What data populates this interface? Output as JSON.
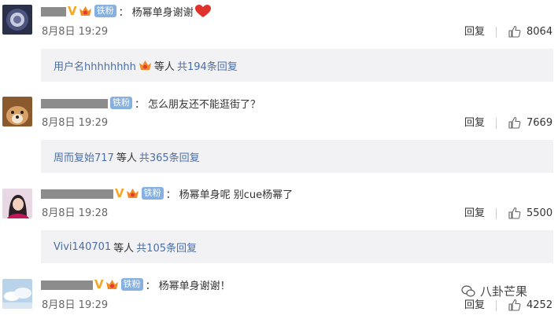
{
  "comments": [
    {
      "badge": "铁粉",
      "colon": "：",
      "text": "杨幂单身谢谢",
      "date": "8月8日 19:29",
      "reply_label": "回复",
      "likes": "8064",
      "replies_user": "用户名hhhhhhhh",
      "replies_mid": "等人",
      "replies_total": "共194条回复"
    },
    {
      "badge": "铁粉",
      "colon": "：",
      "text": "怎么朋友还不能逛街了？",
      "date": "8月8日 19:29",
      "reply_label": "回复",
      "likes": "7669",
      "replies_user": "周而复始717",
      "replies_mid": "等人",
      "replies_total": "共365条回复"
    },
    {
      "badge": "铁粉",
      "colon": "：",
      "text": "杨幂单身呢 别cue杨幂了",
      "date": "8月8日 19:28",
      "reply_label": "回复",
      "likes": "5500",
      "replies_user": "Vivi140701",
      "replies_mid": "等人",
      "replies_total": "共105条回复"
    },
    {
      "badge": "铁粉",
      "colon": "：",
      "text": "杨幂单身谢谢！",
      "date": "8月8日 19:29",
      "reply_label": "回复",
      "likes": "4252"
    }
  ],
  "watermark": "八卦芒果",
  "colors": {
    "link": "#4a6ea8",
    "badge_bg": "#86b0e0",
    "replies_bg": "#f2f2f5",
    "verified": "#f5a623",
    "heart": "#e0322c"
  }
}
